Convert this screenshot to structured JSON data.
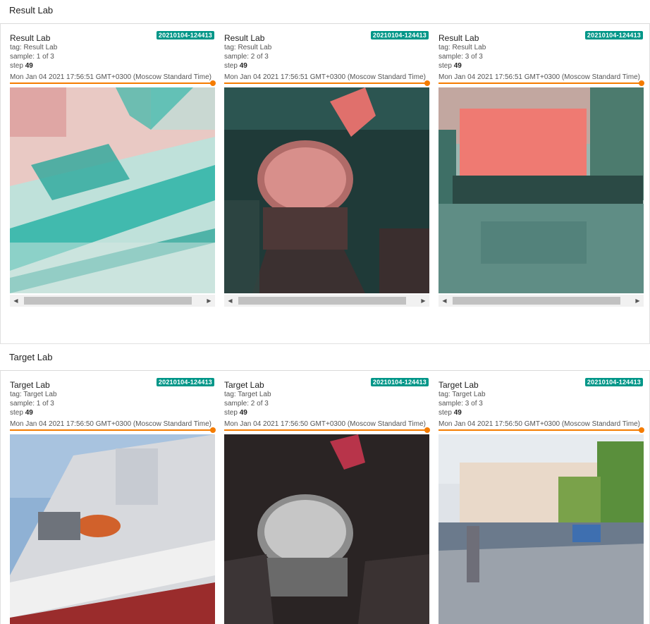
{
  "sections": [
    {
      "title": "Result Lab",
      "cards": [
        {
          "name": "Result Lab",
          "run": "20210104-124413",
          "tag": "tag: Result Lab",
          "sample": "sample: 1 of 3",
          "step_label": "step",
          "step": "49",
          "timestamp": "Mon Jan 04 2021 17:56:51 GMT+0300 (Moscow Standard Time)",
          "image": "ship"
        },
        {
          "name": "Result Lab",
          "run": "20210104-124413",
          "tag": "tag: Result Lab",
          "sample": "sample: 2 of 3",
          "step_label": "step",
          "step": "49",
          "timestamp": "Mon Jan 04 2021 17:56:51 GMT+0300 (Moscow Standard Time)",
          "image": "drum"
        },
        {
          "name": "Result Lab",
          "run": "20210104-124413",
          "tag": "tag: Result Lab",
          "sample": "sample: 3 of 3",
          "step_label": "step",
          "step": "49",
          "timestamp": "Mon Jan 04 2021 17:56:51 GMT+0300 (Moscow Standard Time)",
          "image": "street"
        }
      ]
    },
    {
      "title": "Target Lab",
      "cards": [
        {
          "name": "Target Lab",
          "run": "20210104-124413",
          "tag": "tag: Target Lab",
          "sample": "sample: 1 of 3",
          "step_label": "step",
          "step": "49",
          "timestamp": "Mon Jan 04 2021 17:56:50 GMT+0300 (Moscow Standard Time)",
          "image": "ship"
        },
        {
          "name": "Target Lab",
          "run": "20210104-124413",
          "tag": "tag: Target Lab",
          "sample": "sample: 2 of 3",
          "step_label": "step",
          "step": "49",
          "timestamp": "Mon Jan 04 2021 17:56:50 GMT+0300 (Moscow Standard Time)",
          "image": "drum"
        },
        {
          "name": "Target Lab",
          "run": "20210104-124413",
          "tag": "tag: Target Lab",
          "sample": "sample: 3 of 3",
          "step_label": "step",
          "step": "49",
          "timestamp": "Mon Jan 04 2021 17:56:50 GMT+0300 (Moscow Standard Time)",
          "image": "street"
        }
      ]
    }
  ],
  "scroll_left_icon": "chevron-left-icon",
  "scroll_right_icon": "chevron-right-icon",
  "colors": {
    "accent": "#f57c00",
    "badge": "#009688",
    "result_tint": "#2ec4b6",
    "result_warm": "#f26d6d"
  }
}
